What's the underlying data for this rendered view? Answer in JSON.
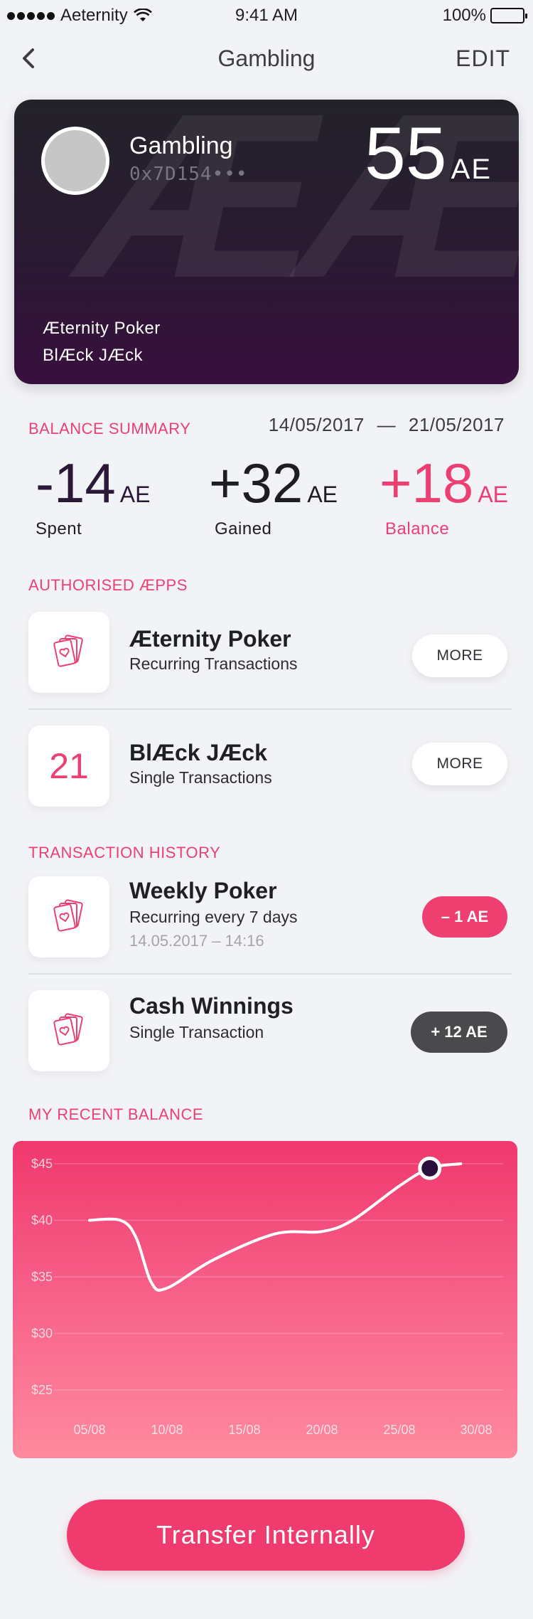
{
  "status_bar": {
    "carrier": "Aeternity",
    "time": "9:41 AM",
    "battery": "100%"
  },
  "nav": {
    "title": "Gambling",
    "edit_label": "EDIT"
  },
  "card": {
    "name": "Gambling",
    "address": "0x7D154•••",
    "balance": "55",
    "unit": "AE",
    "watermark": "ÆÆ",
    "apps": [
      "Æternity Poker",
      "BlÆck JÆck"
    ]
  },
  "balance_summary": {
    "heading": "BALANCE SUMMARY",
    "date_from": "14/05/2017",
    "date_sep": "—",
    "date_to": "21/05/2017",
    "stats": [
      {
        "value": "-14",
        "unit": "AE",
        "label": "Spent",
        "color": "#2b1838"
      },
      {
        "value": "+32",
        "unit": "AE",
        "label": "Gained",
        "color": "#1d1d24"
      },
      {
        "value": "+18",
        "unit": "AE",
        "label": "Balance",
        "color": "#ee3f73"
      }
    ]
  },
  "authorised_apps": {
    "heading": "AUTHORISED ÆPPS",
    "items": [
      {
        "icon": "playing-cards-icon",
        "title": "Æternity Poker",
        "subtitle": "Recurring Transactions",
        "button": "MORE"
      },
      {
        "icon": "twenty-one-icon",
        "icon_text": "21",
        "title": "BlÆck JÆck",
        "subtitle": "Single Transactions",
        "button": "MORE"
      }
    ]
  },
  "transaction_history": {
    "heading": "TRANSACTION HISTORY",
    "items": [
      {
        "icon": "playing-cards-icon",
        "title": "Weekly Poker",
        "subtitle": "Recurring every 7 days",
        "date": "14.05.2017 – 14:16",
        "amount": "– 1 AE",
        "amount_color": "#ef3e70"
      },
      {
        "icon": "playing-cards-icon",
        "title": "Cash Winnings",
        "subtitle": "Single Transaction",
        "amount": "+ 12 AE",
        "amount_color": "#4a4a4d"
      }
    ]
  },
  "recent_balance": {
    "heading": "MY RECENT BALANCE"
  },
  "chart_data": {
    "type": "line",
    "title": "",
    "xlabel": "",
    "ylabel": "",
    "y_ticks": [
      "$45",
      "$40",
      "$35",
      "$30",
      "$25"
    ],
    "x_ticks": [
      "05/08",
      "10/08",
      "15/08",
      "20/08",
      "25/08",
      "30/08"
    ],
    "ylim": [
      23,
      46
    ],
    "grid": true,
    "series": [
      {
        "values": [
          {
            "x": "05/08",
            "y": 40
          },
          {
            "x": "07/08",
            "y": 40
          },
          {
            "x": "08/08",
            "y": 38.5
          },
          {
            "x": "09/08",
            "y": 34.5
          },
          {
            "x": "10/08",
            "y": 34
          },
          {
            "x": "13/08",
            "y": 36.5
          },
          {
            "x": "17/08",
            "y": 38.8
          },
          {
            "x": "20/08",
            "y": 39
          },
          {
            "x": "22/08",
            "y": 40
          },
          {
            "x": "25/08",
            "y": 43
          },
          {
            "x": "27/08",
            "y": 44.6
          },
          {
            "x": "29/08",
            "y": 45
          }
        ]
      }
    ],
    "highlight": {
      "x": "27/08",
      "y": 44.6
    }
  },
  "transfer_button": "Transfer Internally"
}
